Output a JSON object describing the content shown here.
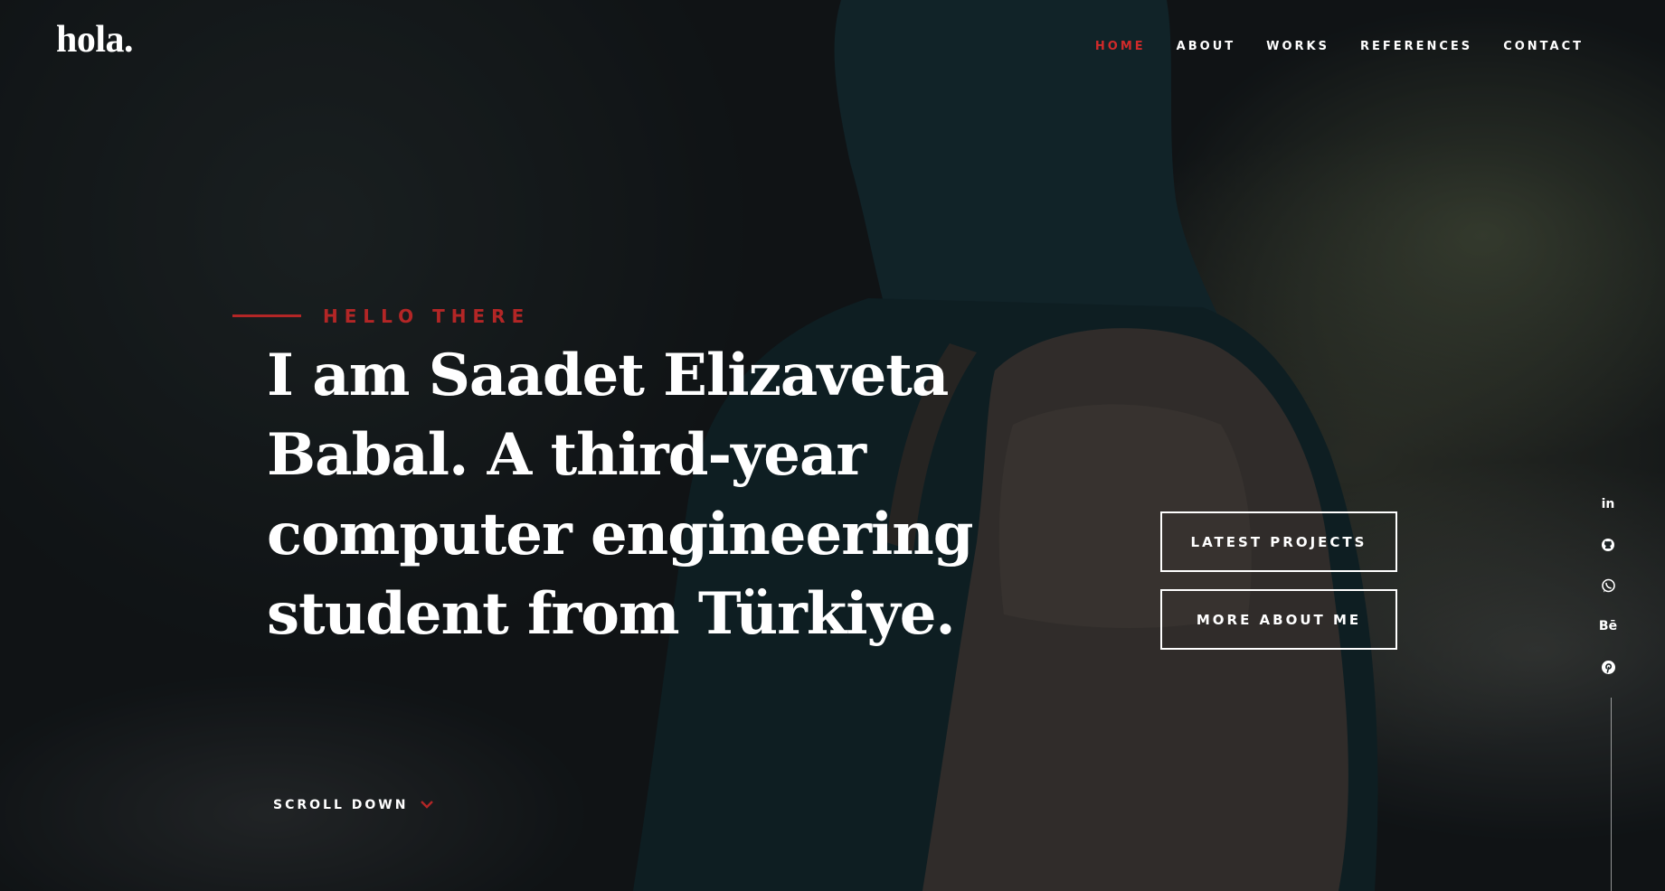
{
  "header": {
    "logo": "hola.",
    "nav": [
      {
        "label": "HOME",
        "active": true
      },
      {
        "label": "ABOUT",
        "active": false
      },
      {
        "label": "WORKS",
        "active": false
      },
      {
        "label": "REFERENCES",
        "active": false
      },
      {
        "label": "CONTACT",
        "active": false
      }
    ]
  },
  "intro": {
    "eyebrow": "HELLO THERE",
    "headline": "I am Saadet Elizaveta Babal. A third-year computer engineering student from Türkiye."
  },
  "buttons": {
    "latest_projects": "LATEST PROJECTS",
    "more_about_me": "MORE ABOUT ME"
  },
  "scroll": {
    "label": "SCROLL DOWN"
  },
  "social": [
    {
      "name": "linkedin-icon",
      "text": "in"
    },
    {
      "name": "github-icon",
      "text": ""
    },
    {
      "name": "whatsapp-icon",
      "text": ""
    },
    {
      "name": "behance-icon",
      "text": "Bē"
    },
    {
      "name": "pinterest-icon",
      "text": ""
    }
  ],
  "colors": {
    "accent": "#b32626",
    "nav_active": "#d02a2a",
    "text": "#ffffff"
  }
}
